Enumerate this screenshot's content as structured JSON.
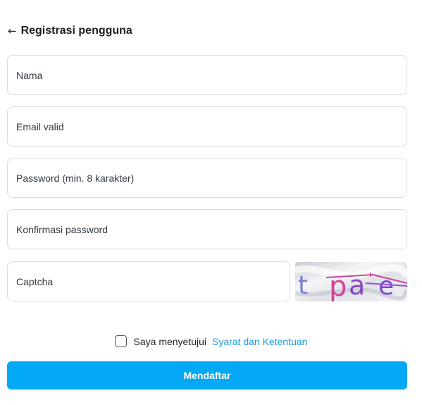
{
  "header": {
    "back_icon": "arrow-left-icon",
    "back_glyph": "←",
    "title": "Registrasi pengguna"
  },
  "form": {
    "name_placeholder": "Nama",
    "email_placeholder": "Email valid",
    "password_placeholder": "Password (min. 8 karakter)",
    "confirm_placeholder": "Konfirmasi password",
    "captcha_placeholder": "Captcha",
    "captcha_text": "t pa e"
  },
  "agreement": {
    "checked": false,
    "text": "Saya menyetujui",
    "link": "Syarat dan Ketentuan"
  },
  "submit_label": "Mendaftar",
  "colors": {
    "accent": "#03a9f4",
    "link": "#1a9ad9",
    "border": "#d9dde3"
  }
}
